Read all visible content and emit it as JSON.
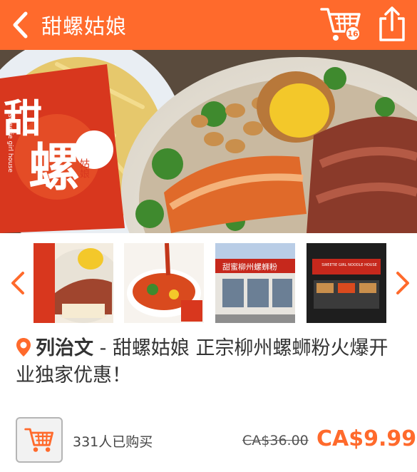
{
  "header": {
    "title": "甜螺姑娘",
    "cart_count": "16",
    "back_icon": "chevron-left-icon",
    "cart_icon": "cart-icon",
    "share_icon": "share-icon"
  },
  "hero": {
    "logo_main_1": "甜",
    "logo_main_2": "螺",
    "logo_small": "姑娘",
    "logo_en": "sweetie girl house"
  },
  "gallery": {
    "thumbs": [
      {
        "alt": "noodle bowl with toppings"
      },
      {
        "alt": "chili oil poured on noodles"
      },
      {
        "alt": "restaurant storefront"
      },
      {
        "alt": "restaurant sign at night"
      }
    ],
    "thumb3_sign": "甜蜜柳州螺蛳粉",
    "thumb4_sign_en": "SWEETIE GIRL NOODLE HOUSE"
  },
  "deal": {
    "city": "列治文",
    "title_rest": " - 甜螺姑娘 正宗柳州螺蛳粉火爆开业独家优惠！",
    "sold_text": "331人已购买",
    "old_price": "CA$36.00",
    "new_price": "CA$9.99"
  },
  "colors": {
    "accent": "#ff6a2c",
    "text": "#333333"
  }
}
